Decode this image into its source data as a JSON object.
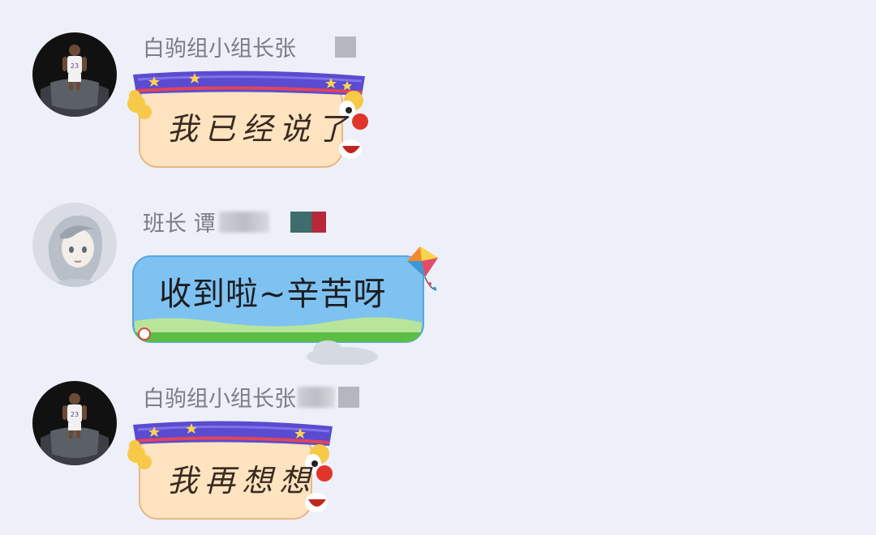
{
  "messages": [
    {
      "sender": "白驹组小组长张",
      "text": "我已经说了",
      "bubble_theme": "clown",
      "avatar": "basketball-player-avatar"
    },
    {
      "sender": "班长 谭",
      "text": "收到啦~辛苦呀",
      "bubble_theme": "sky-kite",
      "avatar": "anime-girl-avatar"
    },
    {
      "sender": "白驹组小组长张",
      "text": "我再想想",
      "bubble_theme": "clown",
      "avatar": "basketball-player-avatar"
    }
  ],
  "colors": {
    "background": "#eef0f9",
    "sender_name": "#7a7d86",
    "clown_hat": "#5a4bd1",
    "clown_body": "#fde3bf",
    "sky_bubble": "#7ec2f2"
  }
}
